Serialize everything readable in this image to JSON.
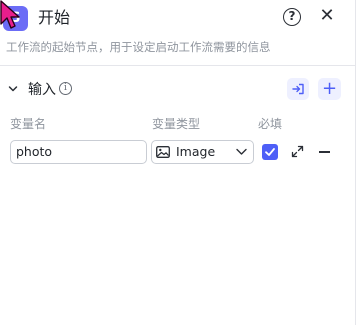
{
  "header": {
    "node_icon_name": "start-node-icon",
    "node_icon_glyph": "S",
    "title": "开始",
    "help_glyph": "?",
    "close_glyph": "✕",
    "accent_color": "#6b6cf6"
  },
  "description": "工作流的起始节点，用于设定启动工作流需要的信息",
  "input_section": {
    "title": "输入",
    "info_glyph": "i",
    "add_glyph": "+",
    "columns": {
      "name": "变量名",
      "type": "变量类型",
      "required": "必填"
    },
    "rows": [
      {
        "name": "photo",
        "type": "Image",
        "required": true
      }
    ]
  },
  "colors": {
    "primary": "#4e5ff7",
    "button_bg": "#eef0ff",
    "muted_text": "#8f959e",
    "cursor": "#e91e8c"
  }
}
